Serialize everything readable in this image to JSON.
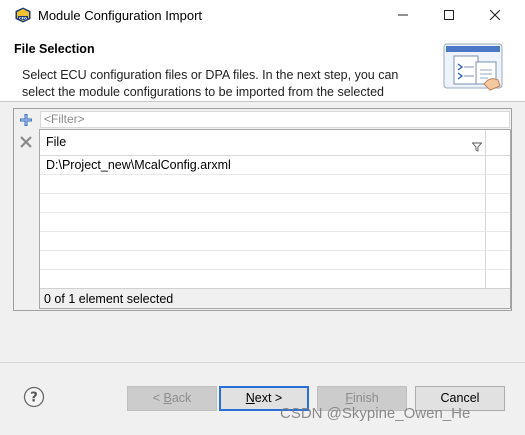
{
  "window": {
    "title": "Module Configuration Import",
    "icon": "eb-tresos-app-icon",
    "minimize_icon": "minimize-icon",
    "maximize_icon": "maximize-icon",
    "close_icon": "close-icon"
  },
  "header": {
    "title": "File Selection",
    "description": "Select ECU configuration files or DPA files. In the next step, you can select the module configurations to be imported from the selected"
  },
  "toolbar": {
    "add_icon": "add-plus-icon",
    "remove_icon": "remove-x-icon"
  },
  "filter": {
    "placeholder": "<Filter>"
  },
  "table": {
    "column": "File",
    "rows": [
      "D:\\Project_new\\McalConfig.arxml",
      "",
      "",
      "",
      "",
      "",
      ""
    ]
  },
  "status": "0 of 1 element selected",
  "buttons": {
    "back_pre": "< ",
    "back_u": "B",
    "back_post": "ack",
    "next_u": "N",
    "next_post": "ext >",
    "finish_u": "F",
    "finish_post": "inish",
    "cancel": "Cancel"
  },
  "watermark": "CSDN @Skypine_Owen_He",
  "colors": {
    "accent": "#2b6fd6",
    "add_icon": "#2f64b5",
    "remove_icon": "#8a8a8a"
  }
}
